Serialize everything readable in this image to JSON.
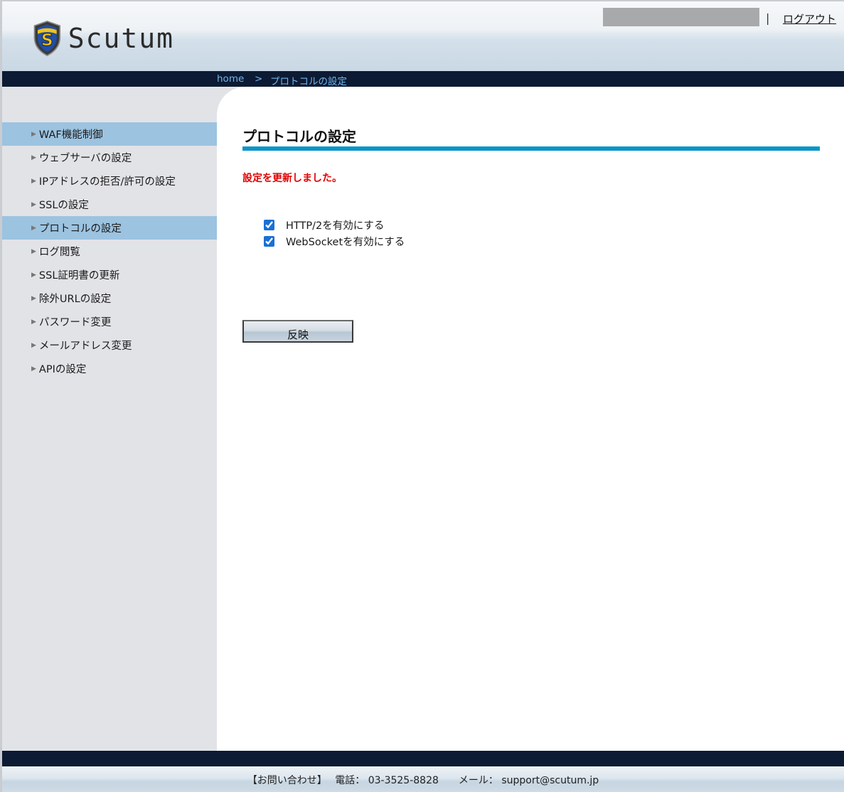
{
  "header": {
    "logo_text": "Scutum",
    "separator": "|",
    "logout_label": "ログアウト"
  },
  "breadcrumb": {
    "home": "home",
    "separator": ">",
    "current": "プロトコルの設定"
  },
  "sidebar": {
    "items": [
      {
        "label": "WAF機能制御",
        "active": true
      },
      {
        "label": "ウェブサーバの設定",
        "active": false
      },
      {
        "label": "IPアドレスの拒否/許可の設定",
        "active": false
      },
      {
        "label": "SSLの設定",
        "active": false
      },
      {
        "label": "プロトコルの設定",
        "active": true
      },
      {
        "label": "ログ閲覧",
        "active": false
      },
      {
        "label": "SSL証明書の更新",
        "active": false
      },
      {
        "label": "除外URLの設定",
        "active": false
      },
      {
        "label": "パスワード変更",
        "active": false
      },
      {
        "label": "メールアドレス変更",
        "active": false
      },
      {
        "label": "APIの設定",
        "active": false
      }
    ],
    "arrow_glyph": "▶"
  },
  "main": {
    "title": "プロトコルの設定",
    "status_message": "設定を更新しました。",
    "options": [
      {
        "label": "HTTP/2を有効にする",
        "checked": true
      },
      {
        "label": "WebSocketを有効にする",
        "checked": true
      }
    ],
    "apply_label": "反映"
  },
  "footer": {
    "contact_line": "【お問い合わせ】　 電話： 03-3525-8828　　メール： support@scutum.jp"
  },
  "colors": {
    "accent_rule": "#0b94c8",
    "status_text": "#e00000",
    "nav_strip": "#0c1a33",
    "sidebar_active": "#9cc3e0"
  }
}
